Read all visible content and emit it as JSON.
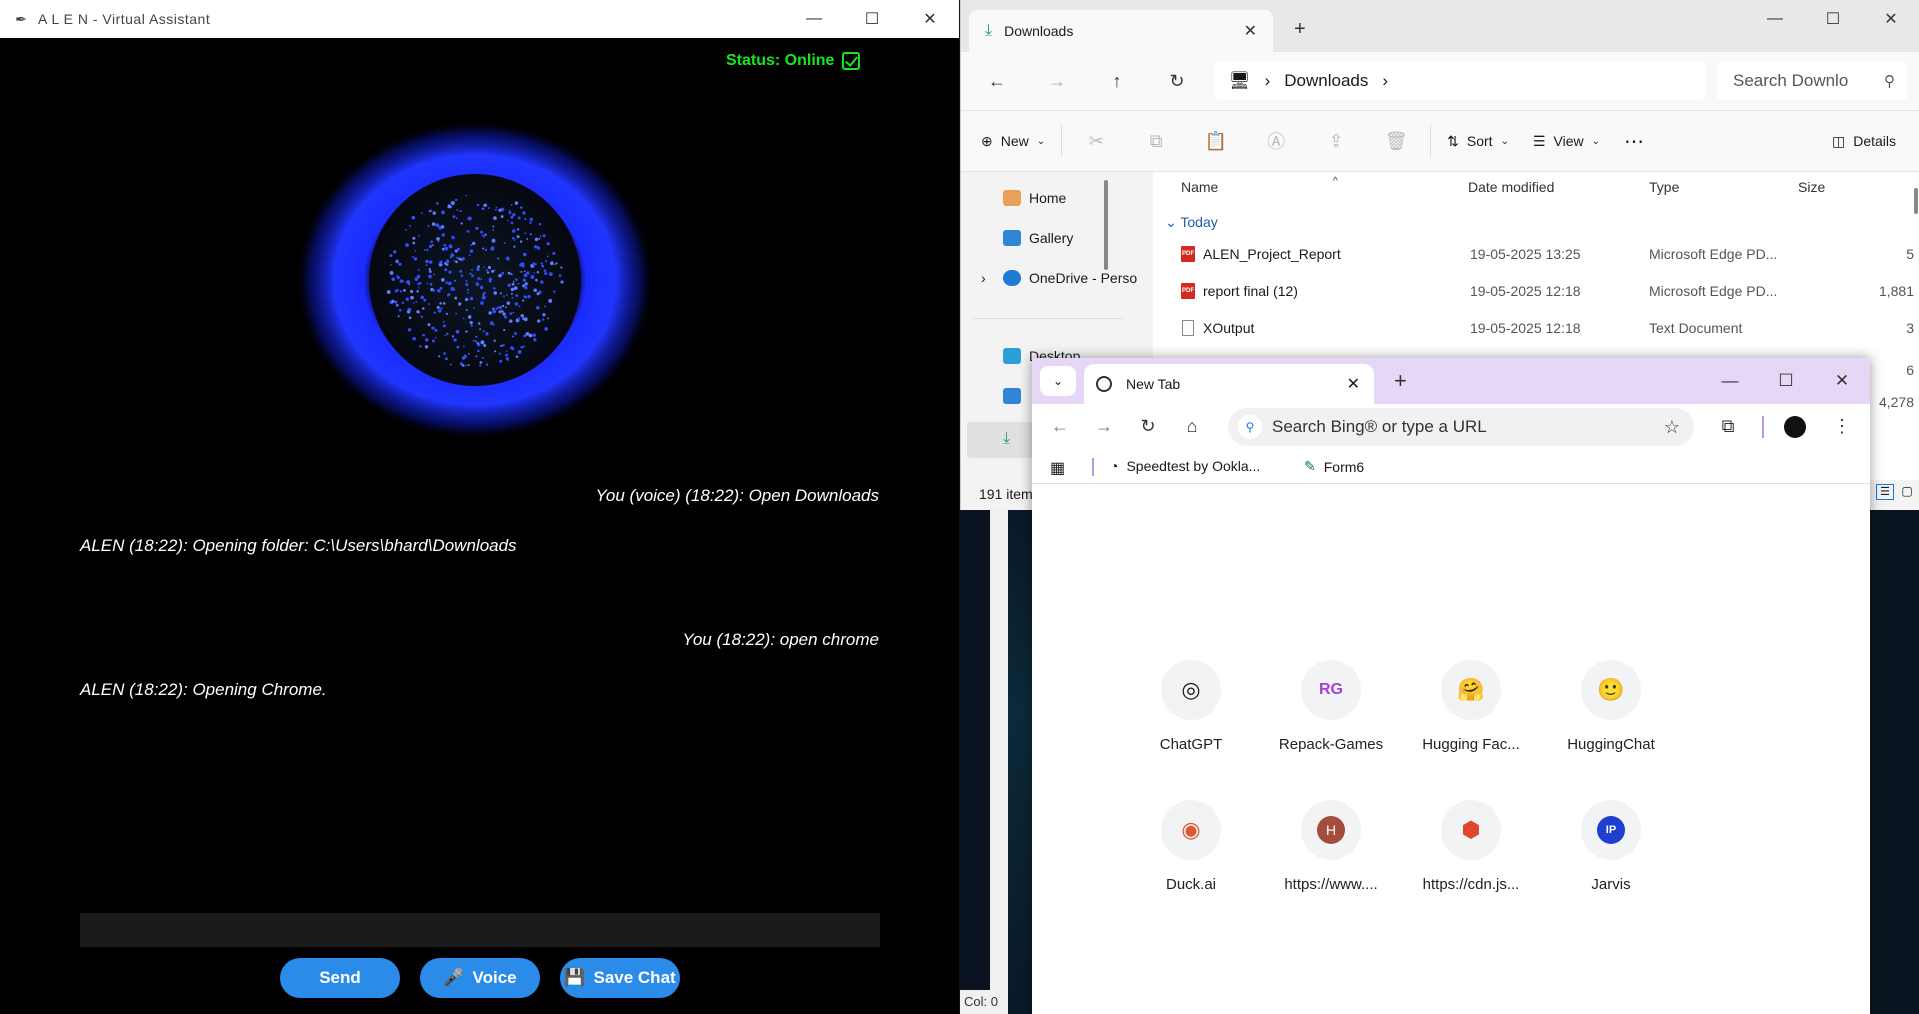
{
  "alen": {
    "title": "A L E N - Virtual Assistant",
    "status": "Status: Online",
    "messages": [
      "You (voice) (18:22):  Open Downloads",
      "ALEN (18:22): Opening folder: C:\\Users\\bhard\\Downloads",
      "You (18:22): open chrome",
      "ALEN (18:22): Opening Chrome."
    ],
    "input_value": "",
    "buttons": {
      "send": "Send",
      "voice": "Voice",
      "save": "Save Chat"
    },
    "colors": {
      "status": "#18e61f",
      "button": "#2a8be8",
      "orb": "#1a2cff"
    }
  },
  "explorer": {
    "tab_title": "Downloads",
    "address": "Downloads",
    "search_placeholder": "Search Downlo",
    "commands": {
      "new": "New",
      "sort": "Sort",
      "view": "View",
      "details": "Details"
    },
    "nav": [
      "Home",
      "Gallery",
      "OneDrive - Perso",
      "Desktop"
    ],
    "columns": {
      "name": "Name",
      "date": "Date modified",
      "type": "Type",
      "size": "Size"
    },
    "group": "Today",
    "files": [
      {
        "name": "ALEN_Project_Report",
        "date": "19-05-2025 13:25",
        "type": "Microsoft Edge PD...",
        "size": "5"
      },
      {
        "name": "report final (12)",
        "date": "19-05-2025 12:18",
        "type": "Microsoft Edge PD...",
        "size": "1,881"
      },
      {
        "name": "XOutput",
        "date": "19-05-2025 12:18",
        "type": "Text Document",
        "size": "3"
      }
    ],
    "extra_sizes": [
      "6",
      "4,278"
    ],
    "status": "191 item",
    "col_indicator": "Col: 0"
  },
  "chrome": {
    "tab_title": "New Tab",
    "omnibox_placeholder": "Search Bing® or type a URL",
    "bookmarks": [
      "Speedtest by Ookla...",
      "Form6"
    ],
    "shortcuts": [
      {
        "label": "ChatGPT",
        "glyph": "◎"
      },
      {
        "label": "Repack-Games",
        "glyph": "RG"
      },
      {
        "label": "Hugging Fac...",
        "glyph": "🤗"
      },
      {
        "label": "HuggingChat",
        "glyph": "🙂"
      },
      {
        "label": "Duck.ai",
        "glyph": "◉"
      },
      {
        "label": "https://www....",
        "glyph": "H"
      },
      {
        "label": "https://cdn.js...",
        "glyph": "⬢"
      },
      {
        "label": "Jarvis",
        "glyph": "IP"
      }
    ]
  }
}
